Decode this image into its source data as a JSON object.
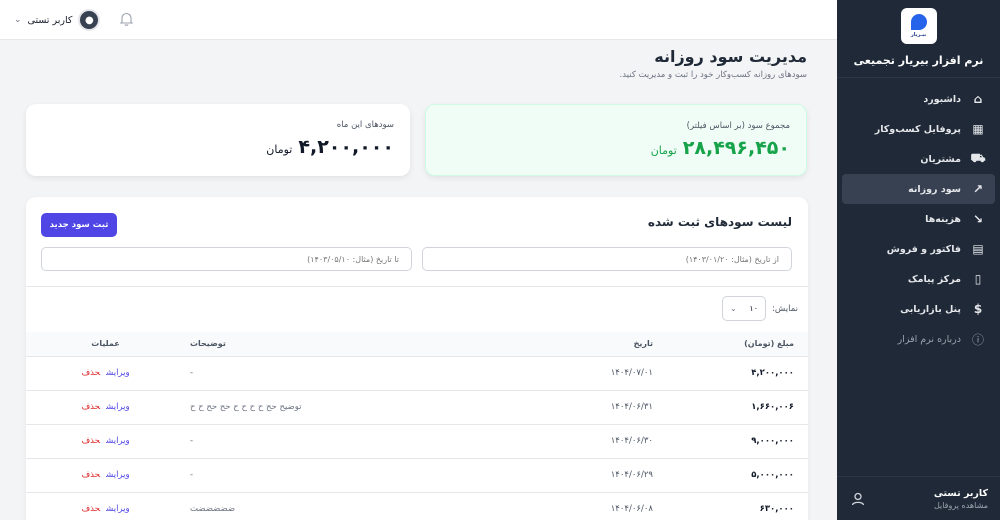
{
  "brand": {
    "logo_text": "بیـریار",
    "title": "نرم افزار بیریار تجمیعی"
  },
  "sidebar": {
    "items": [
      {
        "label": "داشبورد",
        "icon": "home-icon",
        "glyph": "⌂"
      },
      {
        "label": "پروفایل کسب‌وکار",
        "icon": "building-icon",
        "glyph": "▦"
      },
      {
        "label": "مشتریان",
        "icon": "customers-icon",
        "glyph": "⛟"
      },
      {
        "label": "سود روزانه",
        "icon": "trending-up-icon",
        "glyph": "↗"
      },
      {
        "label": "هزینه‌ها",
        "icon": "trending-down-icon",
        "glyph": "↘"
      },
      {
        "label": "فاکتور و فروش",
        "icon": "invoice-icon",
        "glyph": "▤"
      },
      {
        "label": "مرکز پیامک",
        "icon": "message-icon",
        "glyph": "▯"
      },
      {
        "label": "پنل بازاریابی",
        "icon": "dollar-icon",
        "glyph": "$"
      },
      {
        "label": "درباره نرم افزار",
        "icon": "info-icon",
        "glyph": "ⓘ"
      }
    ],
    "active_index": 3,
    "user": {
      "name": "کاربر تستی",
      "sub": "مشاهده پروفایل"
    }
  },
  "topbar": {
    "user_name": "کاربر تستی"
  },
  "page": {
    "title": "مدیریت سود روزانه",
    "subtitle": "سودهای روزانه کسب‌وکار خود را ثبت و مدیریت کنید."
  },
  "stats": {
    "total": {
      "label": "مجموع سود (بر اساس فیلتر)",
      "value": "۲۸,۴۹۶,۴۵۰",
      "unit": "تومان",
      "color": "#16a34a"
    },
    "month": {
      "label": "سودهای این ماه",
      "value": "۴,۲۰۰,۰۰۰",
      "unit": "تومان",
      "color": "#111827"
    }
  },
  "list": {
    "title": "لیست سودهای ثبت شده",
    "new_button": "ثبت سود جدید",
    "filter_from_placeholder": "از تاریخ (مثال: ۱۴۰۳/۰۱/۲۰)",
    "filter_to_placeholder": "تا تاریخ (مثال: ۱۴۰۳/۰۵/۱۰)",
    "show_label": "نمایش:",
    "page_size": "۱۰",
    "columns": {
      "amount": "مبلغ (تومان)",
      "date": "تاریخ",
      "desc": "توضیحات",
      "ops": "عملیات"
    },
    "edit_label": "ویرایش",
    "delete_label": "حذف",
    "rows": [
      {
        "amount": "۴,۲۰۰,۰۰۰",
        "date": "۱۴۰۴/۰۷/۰۱",
        "desc": "-"
      },
      {
        "amount": "۱,۶۶۰,۰۰۶",
        "date": "۱۴۰۴/۰۶/۳۱",
        "desc": "توضیح حح ح ح ح ح حح حح ح ح"
      },
      {
        "amount": "۹,۰۰۰,۰۰۰",
        "date": "۱۴۰۴/۰۶/۳۰",
        "desc": "-"
      },
      {
        "amount": "۵,۰۰۰,۰۰۰",
        "date": "۱۴۰۴/۰۶/۲۹",
        "desc": "-"
      },
      {
        "amount": "۶۳۰,۰۰۰",
        "date": "۱۴۰۴/۰۶/۰۸",
        "desc": "ضضضضضت"
      }
    ]
  }
}
